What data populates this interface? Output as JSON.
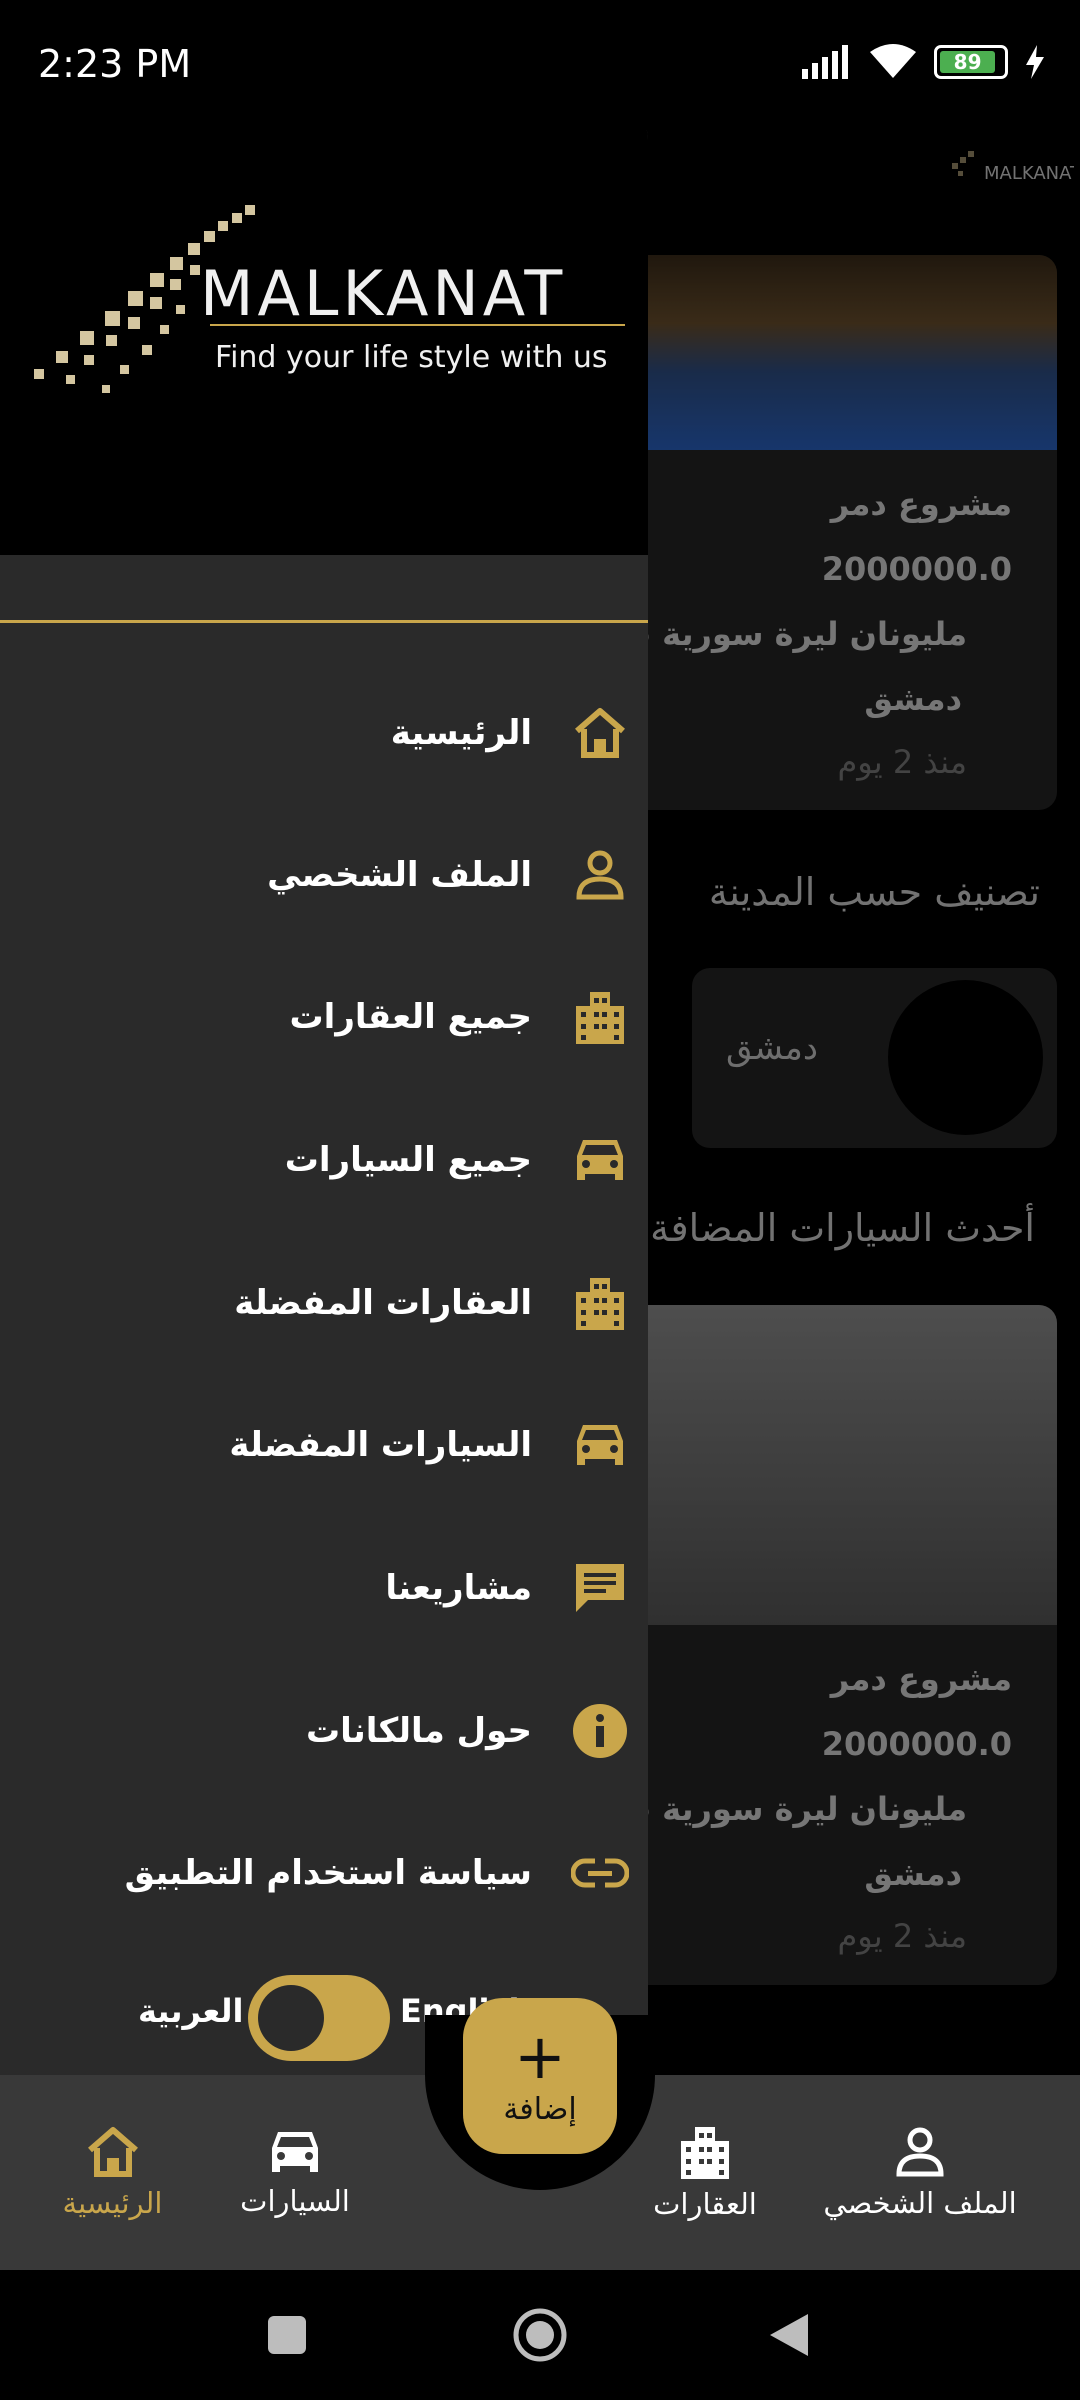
{
  "status_bar": {
    "time": "2:23 PM",
    "battery_level": "89",
    "battery_color": "#4caf50"
  },
  "colors": {
    "accent": "#c9a64b",
    "drawer_bg": "#2a2a2a",
    "nav_bg": "#393939"
  },
  "drawer": {
    "brand": {
      "name": "MALKANAT",
      "tagline": "Find your life style with us"
    },
    "menu": [
      {
        "label": "الرئيسية",
        "icon": "home-icon"
      },
      {
        "label": "الملف الشخصي",
        "icon": "person-icon"
      },
      {
        "label": "جميع العقارات",
        "icon": "building-icon"
      },
      {
        "label": "جميع السيارات",
        "icon": "car-icon"
      },
      {
        "label": "العقارات المفضلة",
        "icon": "building-icon"
      },
      {
        "label": "السيارات المفضلة",
        "icon": "car-icon"
      },
      {
        "label": "مشاريعنا",
        "icon": "message-icon"
      },
      {
        "label": "حول مالكانات",
        "icon": "info-icon"
      },
      {
        "label": "سياسة استخدام التطبيق",
        "icon": "link-icon"
      }
    ],
    "language": {
      "arabic": "العربية",
      "english": "English"
    }
  },
  "background": {
    "card1": {
      "title": "مشروع دمر",
      "price": "2000000.0",
      "price_text": "مليونان ليرة سورية فقط",
      "city": "دمشق",
      "time": "منذ 2 يوم"
    },
    "section_city": "تصنيف حسب المدينة",
    "city_card": "دمشق",
    "section_cars": "أحدث السيارات المضافة",
    "card2": {
      "title": "مشروع دمر",
      "price": "2000000.0",
      "price_text": "مليونان ليرة سورية فقط",
      "city": "دمشق",
      "time": "منذ 2 يوم"
    }
  },
  "bottom_nav": {
    "fab_label": "إضافة",
    "items": [
      {
        "label": "الرئيسية",
        "icon": "home-icon",
        "active": true
      },
      {
        "label": "السيارات",
        "icon": "car-icon",
        "active": false
      },
      {
        "label": "العقارات",
        "icon": "building-icon",
        "active": false
      },
      {
        "label": "الملف الشخصي",
        "icon": "person-icon",
        "active": false
      }
    ]
  }
}
